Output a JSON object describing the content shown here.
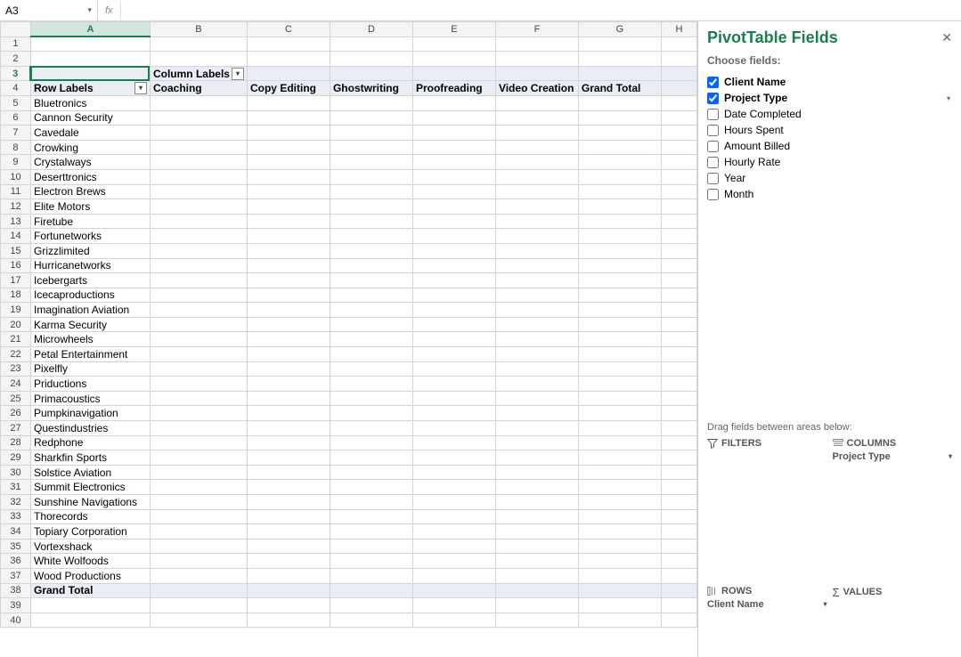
{
  "namebox": {
    "value": "A3",
    "fx": "fx"
  },
  "columns": [
    "A",
    "B",
    "C",
    "D",
    "E",
    "F",
    "G",
    "H"
  ],
  "pivot": {
    "column_labels_header": "Column Labels",
    "row_labels_header": "Row Labels",
    "col_headers": [
      "Coaching",
      "Copy Editing",
      "Ghostwriting",
      "Proofreading",
      "Video Creation",
      "Grand Total"
    ],
    "rows": [
      "Bluetronics",
      "Cannon Security",
      "Cavedale",
      "Crowking",
      "Crystalways",
      "Deserttronics",
      "Electron Brews",
      "Elite Motors",
      "Firetube",
      "Fortunetworks",
      "Grizzlimited",
      "Hurricanetworks",
      "Icebergarts",
      "Icecaproductions",
      "Imagination Aviation",
      "Karma Security",
      "Microwheels",
      "Petal Entertainment",
      "Pixelfly",
      "Priductions",
      "Primacoustics",
      "Pumpkinavigation",
      "Questindustries",
      "Redphone",
      "Sharkfin Sports",
      "Solstice Aviation",
      "Summit Electronics",
      "Sunshine Navigations",
      "Thorecords",
      "Topiary Corporation",
      "Vortexshack",
      "White Wolfoods",
      "Wood Productions"
    ],
    "grand_total": "Grand Total"
  },
  "panel": {
    "title": "PivotTable Fields",
    "choose": "Choose fields:",
    "fields": [
      {
        "label": "Client Name",
        "checked": true,
        "has_dd": false
      },
      {
        "label": "Project Type",
        "checked": true,
        "has_dd": true
      },
      {
        "label": "Date Completed",
        "checked": false,
        "has_dd": false
      },
      {
        "label": "Hours Spent",
        "checked": false,
        "has_dd": false
      },
      {
        "label": "Amount Billed",
        "checked": false,
        "has_dd": false
      },
      {
        "label": "Hourly Rate",
        "checked": false,
        "has_dd": false
      },
      {
        "label": "Year",
        "checked": false,
        "has_dd": false
      },
      {
        "label": "Month",
        "checked": false,
        "has_dd": false
      }
    ],
    "drag_hint": "Drag fields between areas below:",
    "areas": {
      "filters": {
        "title": "FILTERS",
        "items": []
      },
      "columns": {
        "title": "COLUMNS",
        "items": [
          "Project Type"
        ]
      },
      "rows": {
        "title": "ROWS",
        "items": [
          "Client Name"
        ]
      },
      "values": {
        "title": "VALUES",
        "items": []
      }
    }
  }
}
